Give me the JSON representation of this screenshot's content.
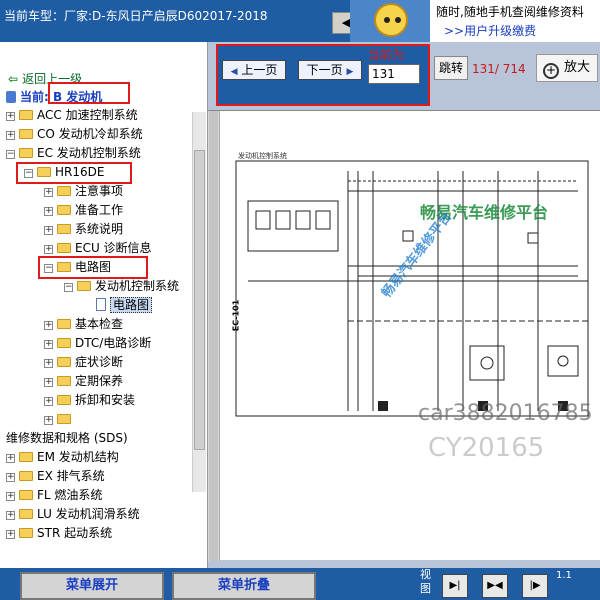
{
  "header": {
    "car_model": "当前车型：厂家:D-东风日产启辰D602017-2018",
    "promo_line1": "随时,随地手机查阅维修资料",
    "promo_line2": ">>用户升级缴费"
  },
  "tree": {
    "back_label": "返回上一级",
    "current_label": "当前: B 发动机",
    "items": [
      {
        "label": "ACC 加速控制系统"
      },
      {
        "label": "CO 发动机冷却系统"
      },
      {
        "label": "EC 发动机控制系统"
      },
      {
        "label": "HR16DE"
      },
      {
        "label": "注意事项"
      },
      {
        "label": "准备工作"
      },
      {
        "label": "系统说明"
      },
      {
        "label": "ECU 诊断信息"
      },
      {
        "label": "电路图"
      },
      {
        "label": "发动机控制系统"
      },
      {
        "label": "电路图"
      },
      {
        "label": "基本检查"
      },
      {
        "label": "DTC/电路诊断"
      },
      {
        "label": "症状诊断"
      },
      {
        "label": "定期保养"
      },
      {
        "label": "拆卸和安装"
      },
      {
        "label": ""
      },
      {
        "label": "维修数据和规格 (SDS)"
      },
      {
        "label": "EM 发动机结构"
      },
      {
        "label": "EX 排气系统"
      },
      {
        "label": "FL 燃油系统"
      },
      {
        "label": "LU 发动机润滑系统"
      },
      {
        "label": "STR 起动系统"
      }
    ]
  },
  "viewer": {
    "prev_label": "上一页",
    "next_label": "下一页",
    "current_page_label": "当前为",
    "current_page_value": "131",
    "jump_label": "跳转",
    "page_count": "131/ 714",
    "zoom_label": "放大",
    "diagram_title": "发动机控制系统",
    "diagram_code": "EC-101",
    "watermark_main": "畅易汽车维修平台",
    "watermark_diag": "畅易汽车维修平台",
    "watermark_id1": "car3882016785",
    "watermark_id2": "CY20165"
  },
  "footer": {
    "expand_label": "菜单展开",
    "collapse_label": "菜单折叠",
    "view_label": "视图",
    "page_indicator": "1.1"
  },
  "colors": {
    "header_bg": "#1e5ca3",
    "highlight_red": "#e01a1a",
    "watermark_green": "#1a8a3a"
  }
}
